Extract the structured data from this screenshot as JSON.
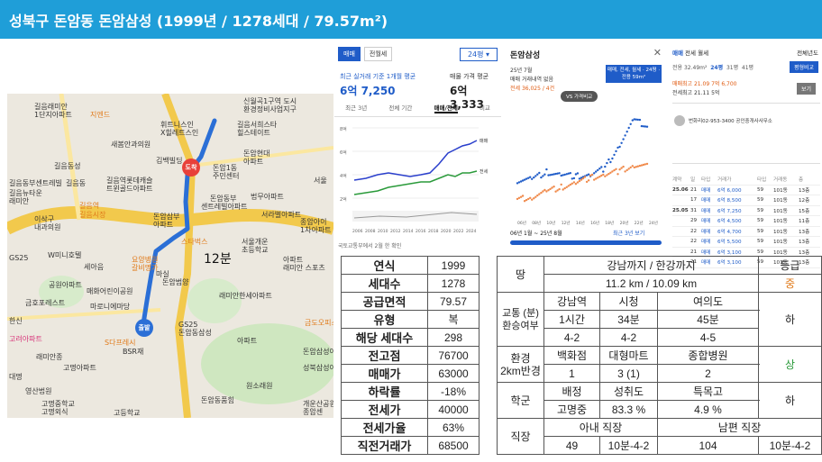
{
  "title": "성북구 돈암동 돈암삼성 (1999년 / 1278세대 / 79.57m²)",
  "map": {
    "route_time": "12분",
    "arrive_label": "도착",
    "depart_label": "출발",
    "labels": [
      "신월곡1구역 도시",
      "환경정비사업지구",
      "길음래미안",
      "1단지아파트",
      "지엔드",
      "휘트니스인",
      "X힐레트스인",
      "길음서희스타",
      "힐스테이트",
      "새봄안과의원",
      "길음동성",
      "길음동부센트레빌",
      "김백빌딩",
      "돈암1동",
      "주민센터",
      "길음동",
      "돈암현대",
      "아파트",
      "길음뉴타운",
      "래미안",
      "길음역",
      "법무아파트",
      "서울",
      "길음시장",
      "길음역롯데캐슬",
      "트윈골드아파트",
      "돈암삼부",
      "아파트",
      "돈암동부",
      "센트레빌아파트",
      "서라벌아파트",
      "종암아이",
      "1차아파트",
      "이삭구",
      "내과의원",
      "GS25",
      "스타벅스",
      "서울개운",
      "초등학교",
      "W미니호텔",
      "세아음",
      "요양병원",
      "갈비명가",
      "마실",
      "돈암범양",
      "아파트",
      "래미안 스포츠",
      "공원아파트",
      "매화어린이공원",
      "금호포레스트",
      "한신",
      "래미안한세아파트",
      "마로니에마당",
      "금도오피스텔",
      "GS25",
      "돈암동삼성",
      "아파트",
      "고려아파트",
      "S다프레시",
      "BSR재",
      "돈암삼성아파트",
      "래미안종",
      "고명아파트",
      "성북삼성아파트",
      "대명",
      "원소래원",
      "영산법원",
      "고명중학교",
      "고명외식",
      "고등학교",
      "돈암동품힘",
      "개운산공원",
      "종암센",
      "아파트"
    ]
  },
  "panel1": {
    "tab_sale": "매매",
    "tab_jeonse": "전월세",
    "size_select": "24평",
    "recent_label": "최근 실거래 기준 1개월 평균",
    "recent_value": "6억 7,250",
    "ask_label": "매물 가격 평균",
    "ask_value": "6억 3,333",
    "period_tabs": [
      "최근 3년",
      "전체 기간",
      "매매/전세",
      "비교"
    ],
    "legend": [
      "매매",
      "전세"
    ],
    "years": [
      "2006",
      "2008",
      "2010",
      "2012",
      "2014",
      "2016",
      "2018",
      "2020",
      "2022",
      "2024"
    ],
    "yticks": [
      "8억",
      "6억",
      "4억",
      "2억"
    ],
    "footnote": "국토교통부에서 2월 한 확인"
  },
  "panel2": {
    "title": "돈암삼성",
    "sub1": "25년 7월",
    "sub2": "매매 거래내역 없음",
    "sub3": "전세 36,025 / 4건",
    "box": "매매, 전세, 월세 · 24평 · 전용 59m²",
    "pill": "VS 가격비교",
    "range": "06년 1월 ~ 25년 8월",
    "range2": "최근 3년 보기",
    "chart_data": {
      "type": "scatter",
      "x_years": [
        "06년",
        "08년",
        "10년",
        "12년",
        "14년",
        "16년",
        "18년",
        "20년",
        "22년",
        "24년"
      ],
      "series": [
        {
          "name": "매매",
          "values": [
            2.6,
            2.7,
            3.2,
            3.0,
            2.9,
            3.0,
            3.5,
            5.2,
            7.0,
            6.5
          ]
        },
        {
          "name": "전세",
          "values": [
            1.2,
            1.4,
            1.8,
            2.1,
            2.4,
            2.8,
            3.0,
            3.3,
            3.7,
            3.6
          ]
        }
      ]
    }
  },
  "panel3": {
    "tab_sale": "매매",
    "tab_jeonse": "전세",
    "tab_wolse": "월세",
    "dropdown": "전체년도",
    "area_label": "전용",
    "area_value": "32.49m²",
    "size24": "24평",
    "size31": "31평",
    "size41": "41평",
    "btn_compare": "평형비교",
    "recent_high": "매매최고 21.09 7억 6,700",
    "recent_low": "전세최고 21.11 5억",
    "btn_more": "보기",
    "broker": "번화리02-953-3400 공인중개사사무소",
    "headers": [
      "계약",
      "일",
      "타입",
      "거래가",
      "타입",
      "거래동",
      "층"
    ],
    "rows": [
      [
        "25.06",
        "21",
        "매매",
        "6억 6,000",
        "59",
        "101동",
        "13층"
      ],
      [
        "",
        "17",
        "매매",
        "6억 8,500",
        "59",
        "101동",
        "12층"
      ],
      [
        "25.05",
        "31",
        "매매",
        "6억 7,250",
        "59",
        "101동",
        "15층"
      ],
      [
        "",
        "29",
        "매매",
        "6억 4,500",
        "59",
        "101동",
        "11층"
      ],
      [
        "",
        "22",
        "매매",
        "6억 4,700",
        "59",
        "101동",
        "13층"
      ],
      [
        "",
        "22",
        "매매",
        "6억 5,500",
        "59",
        "101동",
        "13층"
      ],
      [
        "",
        "21",
        "매매",
        "6억 3,100",
        "59",
        "101동",
        "13층"
      ],
      [
        "",
        "21",
        "매매",
        "6억 3,100",
        "59",
        "101동",
        "13층"
      ]
    ]
  },
  "table1": [
    {
      "k": "연식",
      "v": "1999"
    },
    {
      "k": "세대수",
      "v": "1278"
    },
    {
      "k": "공급면적",
      "v": "79.57"
    },
    {
      "k": "유형",
      "v": "복"
    },
    {
      "k": "해당 세대수",
      "v": "298"
    },
    {
      "k": "전고점",
      "v": "76700"
    },
    {
      "k": "매매가",
      "v": "63000"
    },
    {
      "k": "하락률",
      "v": "-18%"
    },
    {
      "k": "전세가",
      "v": "40000"
    },
    {
      "k": "전세가율",
      "v": "63%"
    },
    {
      "k": "직전거래가",
      "v": "68500"
    }
  ],
  "table2": {
    "land": "땅",
    "land_head": "강남까지 / 한강까지",
    "grade_head": "등급",
    "land_val": "11.2 km / 10.09 km",
    "land_grade": "중",
    "transport": "교통 (분) 환승여부",
    "stations": [
      "강남역",
      "시청",
      "여의도"
    ],
    "times": [
      "1시간",
      "34분",
      "45분"
    ],
    "transfers": [
      "4-2",
      "4-2",
      "4-5"
    ],
    "transport_grade": "하",
    "env": "환경 2km반경",
    "env_heads": [
      "백화점",
      "대형마트",
      "종합병원"
    ],
    "env_vals": [
      "1",
      "3 (1)",
      "2"
    ],
    "env_grade": "상",
    "school": "학군",
    "school_heads": [
      "배정",
      "성취도",
      "특목고"
    ],
    "school_vals": [
      "고명중",
      "83.3 %",
      "4.9 %"
    ],
    "school_grade": "하",
    "job": "직장",
    "job_heads": [
      "아내 직장",
      "남편 직장"
    ],
    "job_vals": [
      "49",
      "10분-4-2",
      "104",
      "10분-4-2"
    ]
  }
}
